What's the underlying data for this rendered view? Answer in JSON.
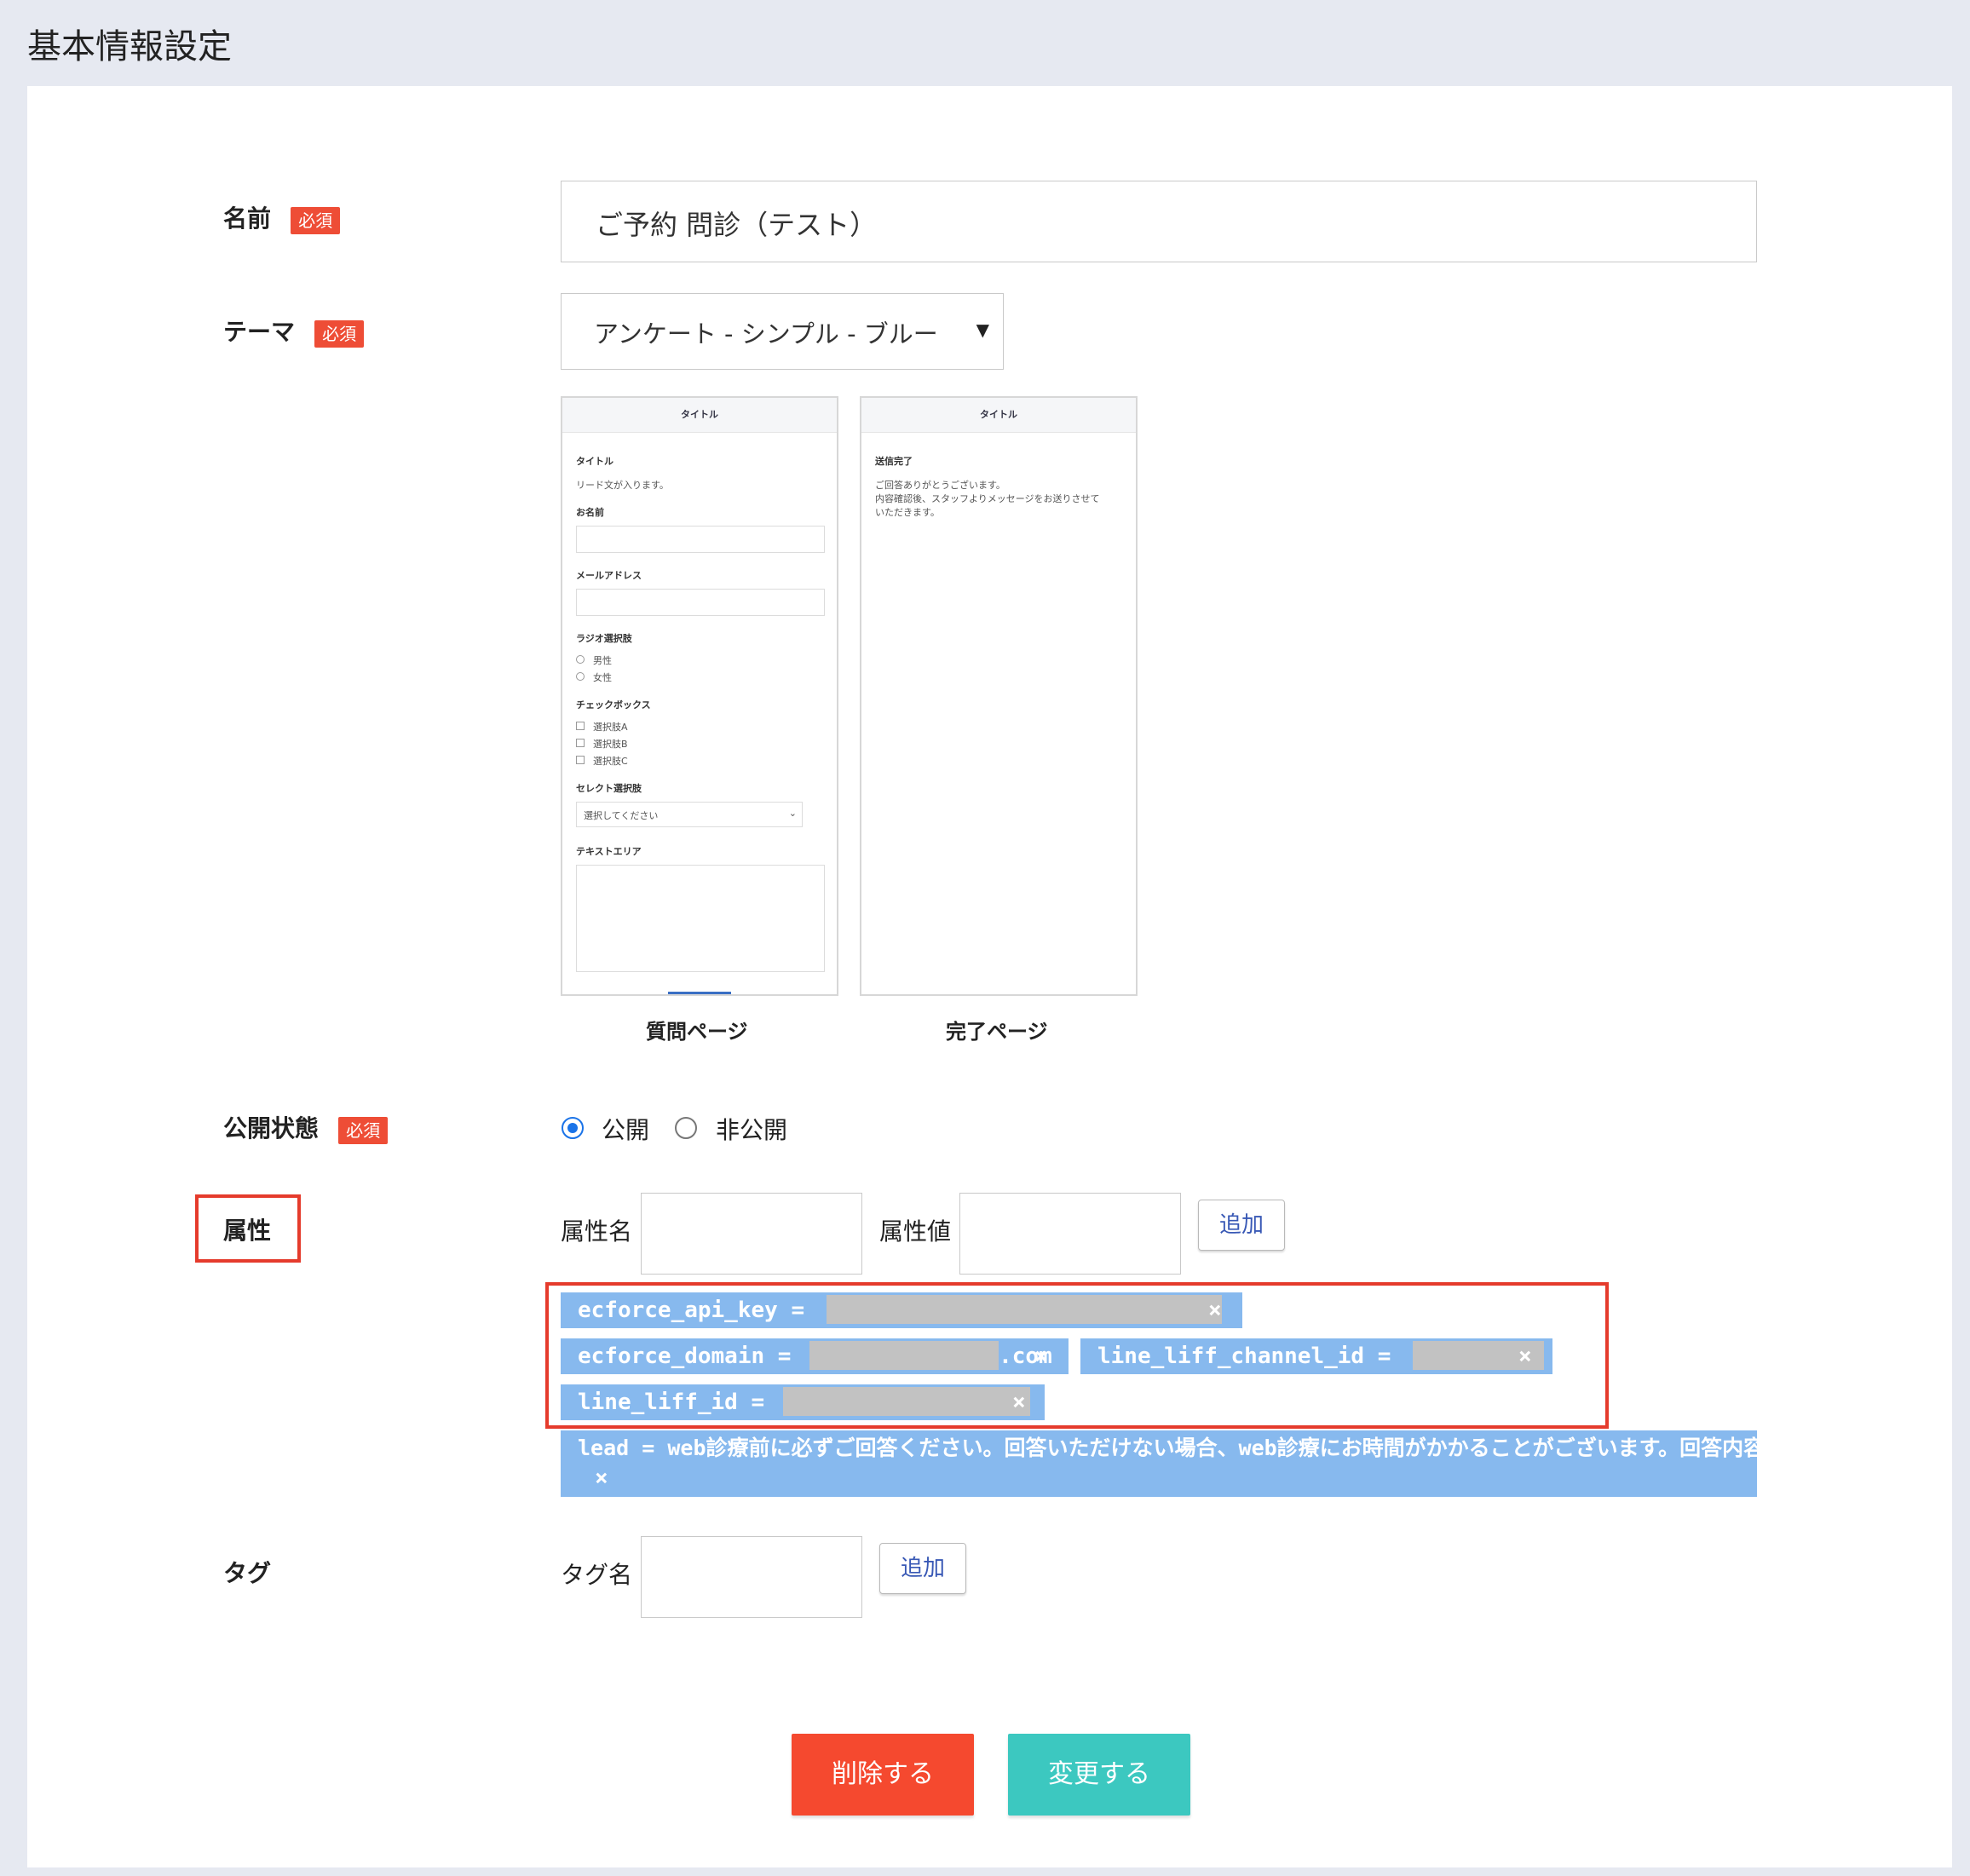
{
  "page": {
    "title": "基本情報設定"
  },
  "form": {
    "required_badge": "必須",
    "name": {
      "label": "名前",
      "value": "ご予約 問診（テスト）"
    },
    "theme": {
      "label": "テーマ",
      "selected": "アンケート - シンプル - ブルー",
      "dropdown_icon": "triangle-down-icon"
    },
    "preview": {
      "question_page": {
        "caption": "質問ページ",
        "header": "タイトル",
        "title": "タイトル",
        "lead": "リード文が入ります。",
        "field_name": "お名前",
        "field_email": "メールアドレス",
        "radio_label": "ラジオ選択肢",
        "radio_options": [
          "男性",
          "女性"
        ],
        "checkbox_label": "チェックボックス",
        "checkbox_options": [
          "選択肢A",
          "選択肢B",
          "選択肢C"
        ],
        "select_label": "セレクト選択肢",
        "select_placeholder": "選択してください",
        "textarea_label": "テキストエリア"
      },
      "complete_page": {
        "caption": "完了ページ",
        "header": "タイトル",
        "title": "送信完了",
        "message_line1": "ご回答ありがとうございます。",
        "message_line2": "内容確認後、スタッフよりメッセージをお送りさせて",
        "message_line3": "いただきます。"
      }
    },
    "status": {
      "label": "公開状態",
      "options": [
        "公開",
        "非公開"
      ],
      "selected": "公開"
    },
    "attributes": {
      "label": "属性",
      "name_label": "属性名",
      "value_label": "属性値",
      "add_button": "追加",
      "remove_symbol": "×",
      "chips": [
        {
          "key_text": "ecforce_api_key =",
          "suffix": ""
        },
        {
          "key_text": "ecforce_domain =",
          "suffix": ".com"
        },
        {
          "key_text": "line_liff_channel_id =",
          "suffix": ""
        },
        {
          "key_text": "line_liff_id =",
          "suffix": ""
        },
        {
          "key_text": "lead = web診療前に必ずご回答ください。回答いただけない場合、web診療にお時間がかかることがございます。回答内容をweb問診時",
          "suffix": ""
        }
      ]
    },
    "tags": {
      "label": "タグ",
      "name_label": "タグ名",
      "add_button": "追加"
    }
  },
  "actions": {
    "delete_button": "削除する",
    "update_button": "変更する"
  },
  "colors": {
    "required_badge": "#ee4d36",
    "chip": "#87b9ee",
    "highlight_box": "#e53b2c",
    "delete_button": "#f5492f",
    "update_button": "#3cc8c0",
    "radio_selected": "#1a73e8"
  }
}
